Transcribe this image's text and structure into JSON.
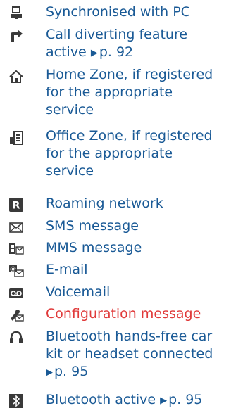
{
  "colors": {
    "text": "#1a5a96",
    "highlight": "#e03a3a",
    "icon": "#3a3a3a"
  },
  "items": [
    {
      "icon": "pc-sync-icon",
      "lines": [
        "Synchronised with PC"
      ]
    },
    {
      "icon": "call-divert-icon",
      "lines": [
        "Call diverting feature",
        "active"
      ],
      "ref": "p. 92"
    },
    {
      "icon": "home-zone-icon",
      "lines": [
        "Home Zone, if registered",
        "for the appropriate",
        "service"
      ]
    },
    {
      "icon": "office-zone-icon",
      "lines": [
        "Office Zone, if registered",
        "for the appropriate",
        "service"
      ]
    },
    {
      "icon": "roaming-icon",
      "lines": [
        "Roaming network"
      ]
    },
    {
      "icon": "sms-icon",
      "lines": [
        "SMS message"
      ]
    },
    {
      "icon": "mms-icon",
      "lines": [
        "MMS message"
      ]
    },
    {
      "icon": "email-icon",
      "lines": [
        "E-mail"
      ]
    },
    {
      "icon": "voicemail-icon",
      "lines": [
        "Voicemail"
      ]
    },
    {
      "icon": "configuration-message-icon",
      "lines": [
        "Configuration message"
      ],
      "highlight": true
    },
    {
      "icon": "bluetooth-headset-icon",
      "lines": [
        "Bluetooth hands-free car",
        "kit or headset connected"
      ],
      "ref": "p. 95"
    },
    {
      "icon": "bluetooth-icon",
      "lines": [
        "Bluetooth active"
      ],
      "ref": "p. 95"
    }
  ]
}
